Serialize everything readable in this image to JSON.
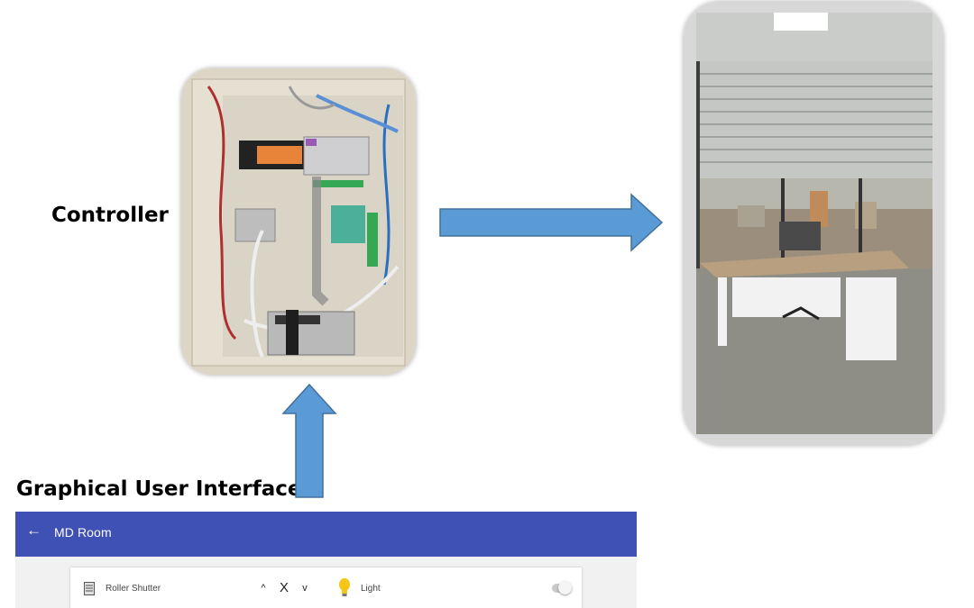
{
  "labels": {
    "controller": "Controller",
    "gui": "Graphical User Interface"
  },
  "gui": {
    "title": "MD Room",
    "back_icon": "arrow-back-icon",
    "roller_shutter": {
      "label": "Roller Shutter",
      "icon": "shutter-icon",
      "up": "^",
      "stop": "X",
      "down": "v"
    },
    "light": {
      "label": "Light",
      "icon": "lightbulb-icon",
      "on": false
    }
  },
  "colors": {
    "arrow": "#5b9bd5",
    "arrow_stroke": "#41719c",
    "appbar": "#3f51b5",
    "bulb": "#f5c518"
  }
}
